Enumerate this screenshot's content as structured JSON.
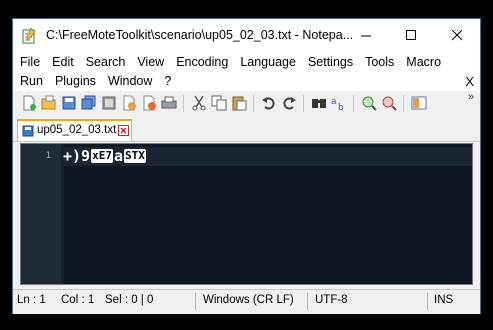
{
  "window": {
    "title": "C:\\FreeMoteToolkit\\scenario\\up05_02_03.txt - Notepa...",
    "minimize_glyph": "—",
    "maximize_glyph": "☐",
    "close_glyph": "✕"
  },
  "menu": {
    "row1": [
      "File",
      "Edit",
      "Search",
      "View",
      "Encoding",
      "Language",
      "Settings",
      "Tools",
      "Macro"
    ],
    "row2": [
      "Run",
      "Plugins",
      "Window",
      "?"
    ],
    "close_doc": "X"
  },
  "toolbar": {
    "icons": [
      "new-file-icon",
      "open-file-icon",
      "save-icon",
      "save-all-icon",
      "close-icon",
      "close-all-icon",
      "print-icon",
      "cut-icon",
      "copy-icon",
      "paste-icon",
      "undo-icon",
      "redo-icon",
      "find-icon",
      "replace-icon",
      "zoom-in-icon",
      "zoom-out-icon",
      "sync-icon"
    ],
    "overflow": "»"
  },
  "tab": {
    "label": "up05_02_03.txt"
  },
  "editor": {
    "line_number": "1",
    "text_prefix": "+)9",
    "ctl1": "xE7",
    "mid": "a",
    "ctl2": "STX"
  },
  "status": {
    "line": "Ln : 1",
    "col": "Col : 1",
    "sel": "Sel : 0 | 0",
    "eol": "Windows (CR LF)",
    "encoding": "UTF-8",
    "mode": "INS"
  },
  "colors": {
    "editor_bg": "#0f1822",
    "tab_accent": "#f0a030"
  }
}
